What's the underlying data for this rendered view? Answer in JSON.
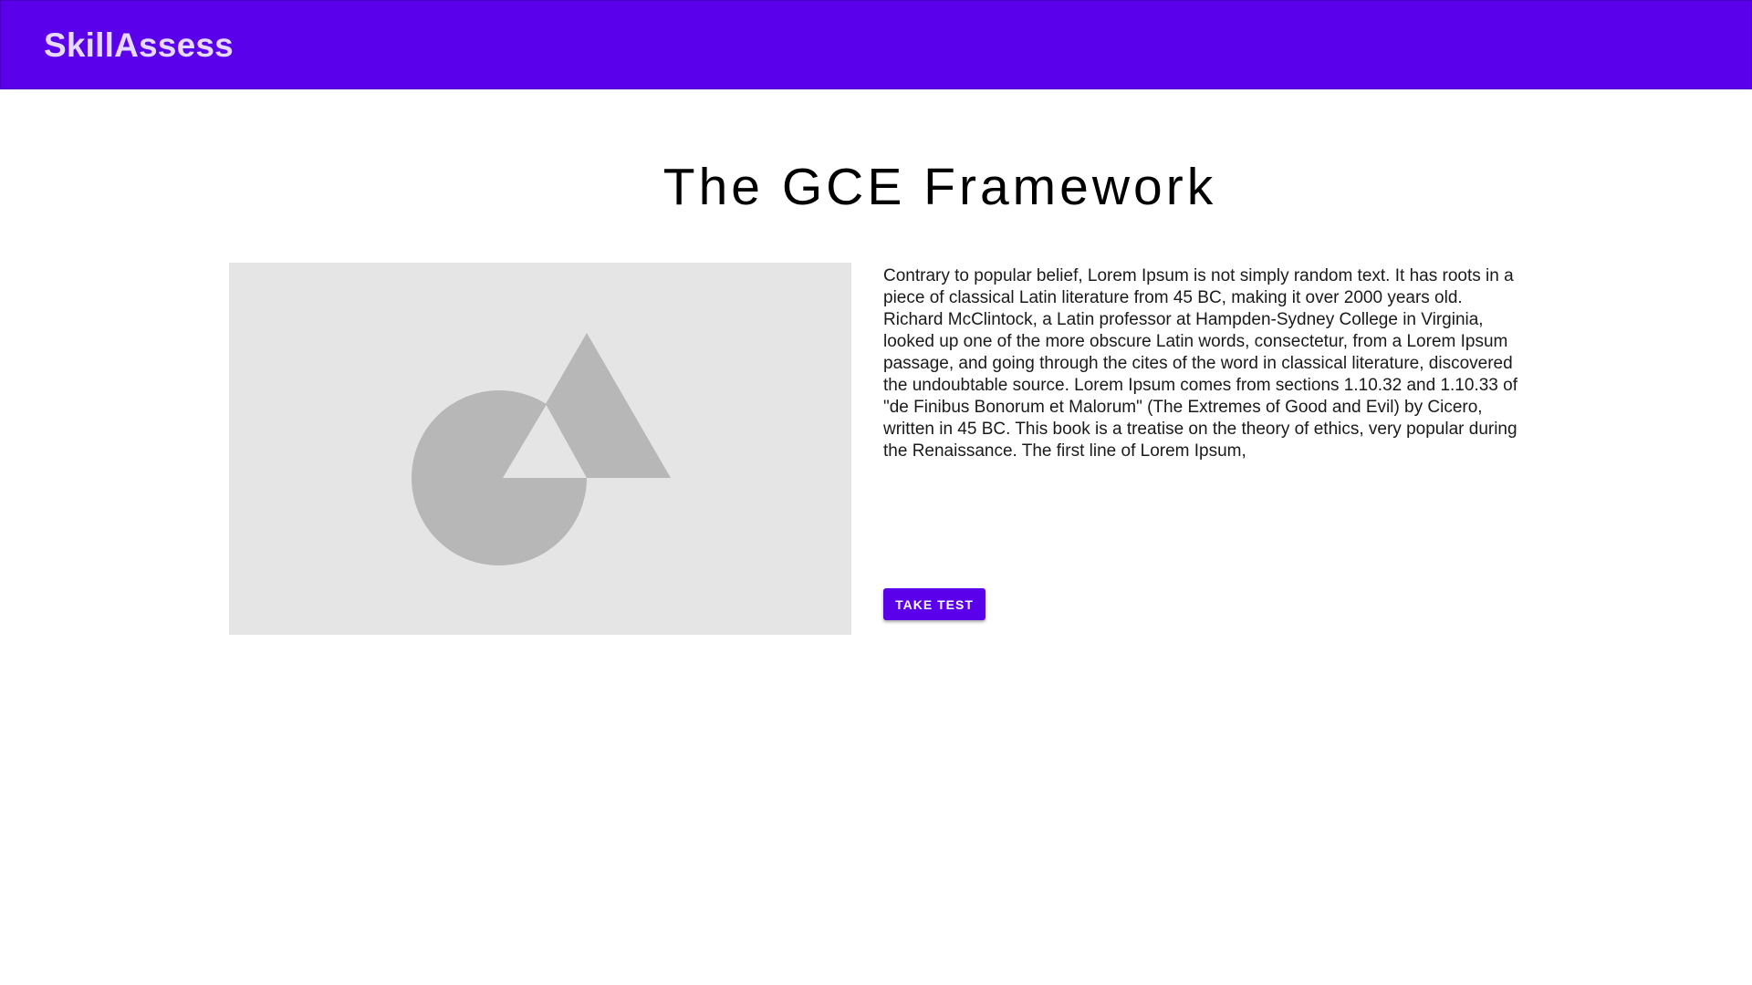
{
  "header": {
    "brand": "SkillAssess",
    "background_color": "#5b00ea"
  },
  "main": {
    "title": "The GCE Framework",
    "image": {
      "icon": "image-placeholder-icon"
    },
    "description": "Contrary to popular belief, Lorem Ipsum is not simply random text. It has roots in a piece of classical Latin literature from 45 BC, making it over 2000 years old. Richard McClintock, a Latin professor at Hampden-Sydney College in Virginia, looked up one of the more obscure Latin words, consectetur, from a Lorem Ipsum passage, and going through the cites of the word in classical literature, discovered the undoubtable source. Lorem Ipsum comes from sections 1.10.32 and 1.10.33 of \"de Finibus Bonorum et Malorum\" (The Extremes of Good and Evil) by Cicero, written in 45 BC. This book is a treatise on the theory of ethics, very popular during the Renaissance. The first line of Lorem Ipsum,",
    "button_label": "TAKE TEST",
    "accent_color": "#5b00ea"
  }
}
